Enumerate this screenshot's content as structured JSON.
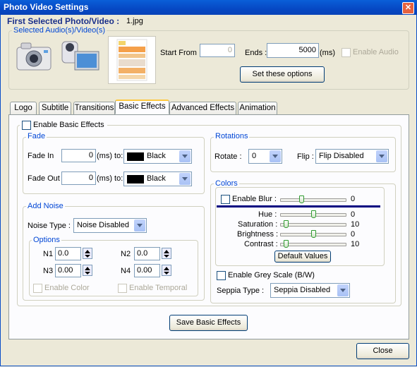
{
  "window": {
    "title": "Photo Video Settings"
  },
  "header": {
    "first_selected_label": "First Selected Photo/Video :",
    "first_selected_value": "1.jpg",
    "audio_group_label": "Selected Audio(s)/Video(s)",
    "start_from_label": "Start From :",
    "start_from_value": "0",
    "ends_label": "Ends :",
    "ends_value": "5000",
    "ends_unit": "(ms)",
    "enable_audio_label": "Enable Audio",
    "set_options_label": "Set these options"
  },
  "tabs": [
    {
      "label": "Logo"
    },
    {
      "label": "Subtitle"
    },
    {
      "label": "Transitions"
    },
    {
      "label": "Basic Effects"
    },
    {
      "label": "Advanced Effects"
    },
    {
      "label": "Animation"
    }
  ],
  "basic_effects": {
    "enable_label": "Enable Basic Effects",
    "fade": {
      "group_label": "Fade",
      "fade_in_label": "Fade In",
      "fade_in_value": "0",
      "fade_out_label": "Fade Out",
      "fade_out_value": "0",
      "ms_to": "(ms) to:",
      "fade_in_color": "Black",
      "fade_out_color": "Black"
    },
    "noise": {
      "group_label": "Add Noise",
      "type_label": "Noise Type :",
      "type_value": "Noise Disabled",
      "options_label": "Options",
      "n1_label": "N1",
      "n1_value": "0.0",
      "n2_label": "N2",
      "n2_value": "0.0",
      "n3_label": "N3",
      "n3_value": "0.00",
      "n4_label": "N4",
      "n4_value": "0.00",
      "enable_color_label": "Enable Color",
      "enable_temporal_label": "Enable Temporal"
    },
    "rotations": {
      "group_label": "Rotations",
      "rotate_label": "Rotate :",
      "rotate_value": "0",
      "flip_label": "Flip :",
      "flip_value": "Flip Disabled"
    },
    "colors": {
      "group_label": "Colors",
      "enable_blur_label": "Enable Blur :",
      "blur_value": "0",
      "blur_level": 0.3,
      "hue_label": "Hue :",
      "hue_value": "0",
      "hue_level": 0.5,
      "saturation_label": "Saturation :",
      "saturation_value": "10",
      "saturation_level": 0.05,
      "brightness_label": "Brightness :",
      "brightness_value": "0",
      "brightness_level": 0.5,
      "contrast_label": "Contrast :",
      "contrast_value": "10",
      "contrast_level": 0.05,
      "default_values_label": "Default Values",
      "grey_scale_label": "Enable Grey Scale (B/W)",
      "seppia_label": "Seppia Type :",
      "seppia_value": "Seppia Disabled"
    },
    "save_label": "Save Basic Effects"
  },
  "footer": {
    "close_label": "Close"
  },
  "colors": {
    "title_bar": "#0a5fd8",
    "group_label": "#0046d5",
    "blur_bar": "#000080"
  }
}
